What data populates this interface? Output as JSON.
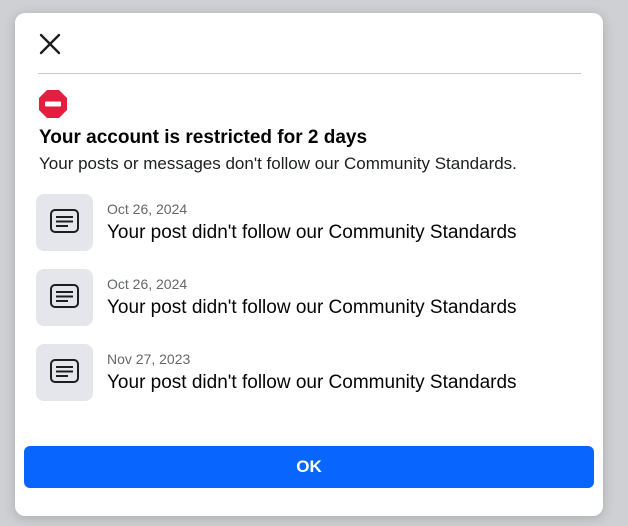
{
  "dialog": {
    "title": "Your account is restricted for 2 days",
    "subtitle": "Your posts or messages don't follow our Community Standards.",
    "close_icon": "close-icon",
    "status_icon": "restricted-icon",
    "violations": [
      {
        "date": "Oct 26, 2024",
        "text": "Your post didn't follow our Community Standards",
        "icon": "document-icon"
      },
      {
        "date": "Oct 26, 2024",
        "text": "Your post didn't follow our Community Standards",
        "icon": "document-icon"
      },
      {
        "date": "Nov 27, 2023",
        "text": "Your post didn't follow our Community Standards",
        "icon": "document-icon"
      }
    ],
    "ok_label": "OK"
  },
  "colors": {
    "primary_button": "#0866ff",
    "restricted_red": "#e41e3f",
    "tile_bg": "#e4e6eb"
  }
}
